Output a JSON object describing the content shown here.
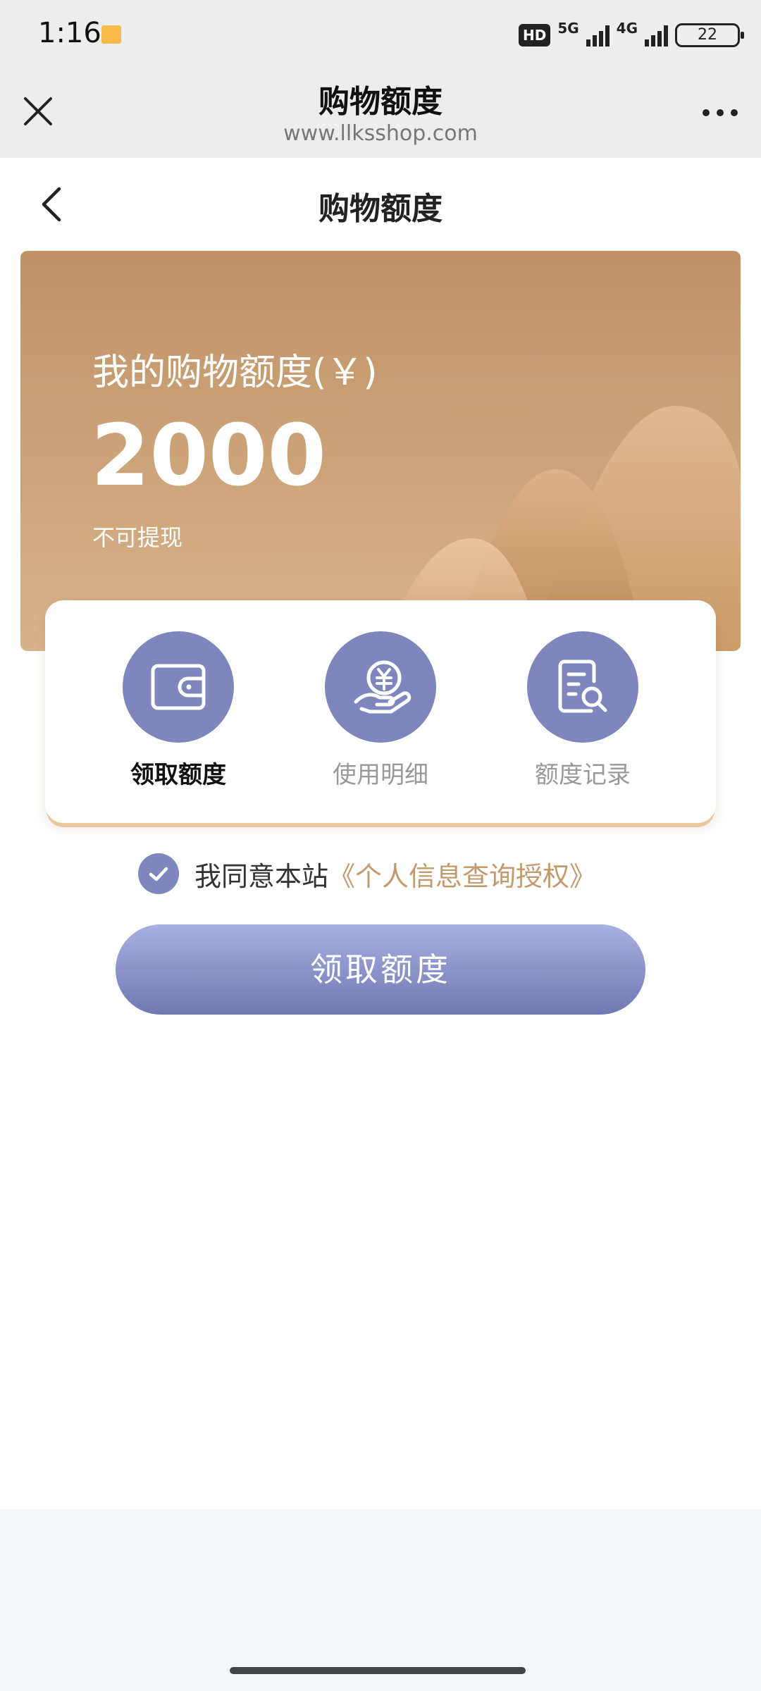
{
  "status_bar": {
    "time": "1:16",
    "hd_badge": "HD",
    "net1": "5G",
    "net2": "4G",
    "battery": "22"
  },
  "browser": {
    "title": "购物额度",
    "url": "www.llksshop.com",
    "close_icon": "close-icon",
    "more_icon": "more-icon"
  },
  "page": {
    "title": "购物额度",
    "back_icon": "chevron-left-icon"
  },
  "banner": {
    "label": "我的购物额度(￥)",
    "amount": "2000",
    "note": "不可提现"
  },
  "actions": [
    {
      "label": "领取额度",
      "icon": "wallet-icon",
      "active": true
    },
    {
      "label": "使用明细",
      "icon": "yuan-hand-icon",
      "active": false
    },
    {
      "label": "额度记录",
      "icon": "document-search-icon",
      "active": false
    }
  ],
  "agreement": {
    "checked": true,
    "text": "我同意本站",
    "link": "《个人信息查询授权》"
  },
  "main_button": "领取额度",
  "colors": {
    "banner": "#c59b6f",
    "accent": "#7f86be",
    "link": "#c49a6c"
  }
}
